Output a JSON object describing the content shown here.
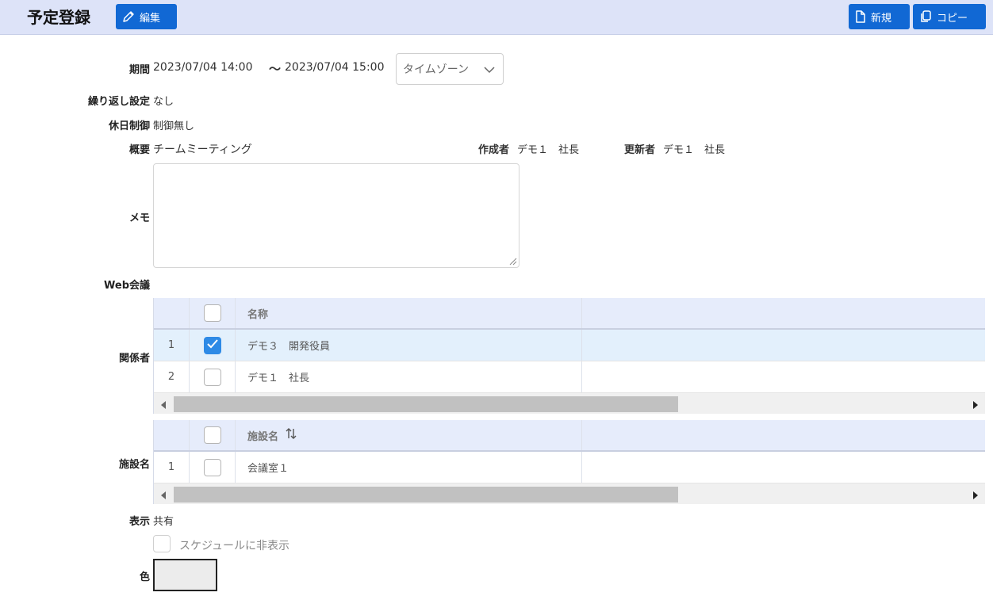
{
  "header": {
    "title": "予定登録",
    "edit_label": "編集",
    "new_label": "新規",
    "copy_label": "コピー"
  },
  "form": {
    "period_label": "期間",
    "period_start": "2023/07/04 14:00",
    "period_sep": "～",
    "period_end": "2023/07/04 15:00",
    "timezone_placeholder": "タイムゾーン",
    "repeat_label": "繰り返し設定",
    "repeat_value": "なし",
    "holiday_label": "休日制御",
    "holiday_value": "制御無し",
    "summary_label": "概要",
    "summary_value": "チームミーティング",
    "creator_label": "作成者",
    "creator_value": "デモ１　社長",
    "updater_label": "更新者",
    "updater_value": "デモ１　社長",
    "memo_label": "メモ",
    "memo_value": "",
    "web_meeting_label": "Web会議",
    "participants_label": "関係者",
    "facility_label": "施設名",
    "display_label": "表示",
    "display_value": "共有",
    "hide_schedule_label": "スケジュールに非表示",
    "color_label": "色",
    "color_value": "#ececec"
  },
  "participants_table": {
    "header_name": "名称",
    "rows": [
      {
        "num": "1",
        "checked": true,
        "name": "デモ３　開発役員"
      },
      {
        "num": "2",
        "checked": false,
        "name": "デモ１　社長"
      }
    ]
  },
  "facility_table": {
    "header_name": "施設名",
    "sort_icon": "sort-icon",
    "rows": [
      {
        "num": "1",
        "checked": false,
        "name": "会議室１"
      }
    ]
  },
  "colors": {
    "header_bg": "#dde3f8",
    "button_bg": "#1168d4",
    "checked": "#2e8ae6",
    "selected_row": "#e3f0fc"
  }
}
